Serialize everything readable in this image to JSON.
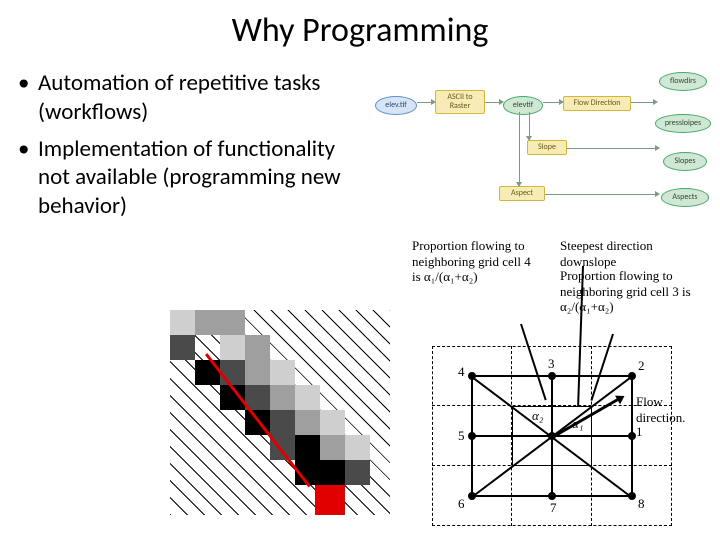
{
  "title": "Why Programming",
  "bullets": [
    "Automation of repetitive tasks (workflows)",
    "Implementation of functionality not available (programming new behavior)"
  ],
  "flowchart": {
    "nodes": {
      "elev": "elev.tif",
      "ascii": "ASCII to Raster",
      "elevtif": "elevtif",
      "flowdir": "Flow Direction",
      "slope": "Slope",
      "aspect": "Aspect",
      "flowdirsO": "flowdirs",
      "pressloipesO": "pressloipes",
      "slopesO": "Slopes",
      "aspectsO": "Aspects"
    }
  },
  "gridfig": {
    "label_prop4": "Proportion flowing to neighboring grid cell 4 is α₁/(α₁+α₂)",
    "label_steep": "Steepest direction downslope",
    "label_prop3": "Proportion flowing to neighboring grid cell 3 is α₂/(α₁+α₂)",
    "label_flowdir": "Flow direction.",
    "n1": "1",
    "n2": "2",
    "n3": "3",
    "n4": "4",
    "n5": "5",
    "n6": "6",
    "n7": "7",
    "n8": "8",
    "a1": "α₁",
    "a2": "α₂"
  }
}
